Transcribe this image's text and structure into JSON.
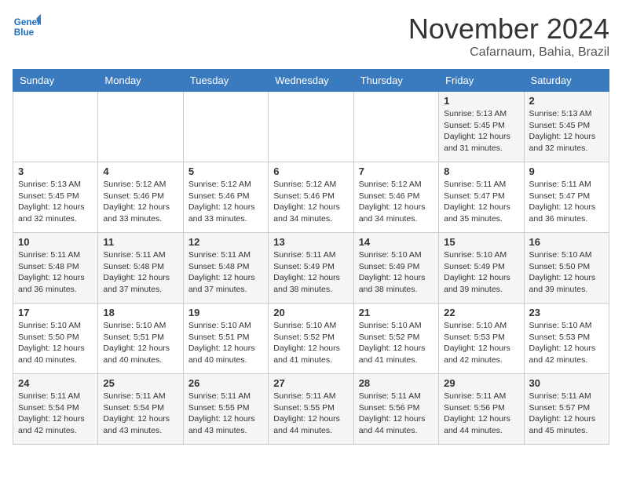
{
  "header": {
    "logo_line1": "General",
    "logo_line2": "Blue",
    "month": "November 2024",
    "location": "Cafarnaum, Bahia, Brazil"
  },
  "weekdays": [
    "Sunday",
    "Monday",
    "Tuesday",
    "Wednesday",
    "Thursday",
    "Friday",
    "Saturday"
  ],
  "weeks": [
    [
      {
        "day": "",
        "info": ""
      },
      {
        "day": "",
        "info": ""
      },
      {
        "day": "",
        "info": ""
      },
      {
        "day": "",
        "info": ""
      },
      {
        "day": "",
        "info": ""
      },
      {
        "day": "1",
        "info": "Sunrise: 5:13 AM\nSunset: 5:45 PM\nDaylight: 12 hours\nand 31 minutes."
      },
      {
        "day": "2",
        "info": "Sunrise: 5:13 AM\nSunset: 5:45 PM\nDaylight: 12 hours\nand 32 minutes."
      }
    ],
    [
      {
        "day": "3",
        "info": "Sunrise: 5:13 AM\nSunset: 5:45 PM\nDaylight: 12 hours\nand 32 minutes."
      },
      {
        "day": "4",
        "info": "Sunrise: 5:12 AM\nSunset: 5:46 PM\nDaylight: 12 hours\nand 33 minutes."
      },
      {
        "day": "5",
        "info": "Sunrise: 5:12 AM\nSunset: 5:46 PM\nDaylight: 12 hours\nand 33 minutes."
      },
      {
        "day": "6",
        "info": "Sunrise: 5:12 AM\nSunset: 5:46 PM\nDaylight: 12 hours\nand 34 minutes."
      },
      {
        "day": "7",
        "info": "Sunrise: 5:12 AM\nSunset: 5:46 PM\nDaylight: 12 hours\nand 34 minutes."
      },
      {
        "day": "8",
        "info": "Sunrise: 5:11 AM\nSunset: 5:47 PM\nDaylight: 12 hours\nand 35 minutes."
      },
      {
        "day": "9",
        "info": "Sunrise: 5:11 AM\nSunset: 5:47 PM\nDaylight: 12 hours\nand 36 minutes."
      }
    ],
    [
      {
        "day": "10",
        "info": "Sunrise: 5:11 AM\nSunset: 5:48 PM\nDaylight: 12 hours\nand 36 minutes."
      },
      {
        "day": "11",
        "info": "Sunrise: 5:11 AM\nSunset: 5:48 PM\nDaylight: 12 hours\nand 37 minutes."
      },
      {
        "day": "12",
        "info": "Sunrise: 5:11 AM\nSunset: 5:48 PM\nDaylight: 12 hours\nand 37 minutes."
      },
      {
        "day": "13",
        "info": "Sunrise: 5:11 AM\nSunset: 5:49 PM\nDaylight: 12 hours\nand 38 minutes."
      },
      {
        "day": "14",
        "info": "Sunrise: 5:10 AM\nSunset: 5:49 PM\nDaylight: 12 hours\nand 38 minutes."
      },
      {
        "day": "15",
        "info": "Sunrise: 5:10 AM\nSunset: 5:49 PM\nDaylight: 12 hours\nand 39 minutes."
      },
      {
        "day": "16",
        "info": "Sunrise: 5:10 AM\nSunset: 5:50 PM\nDaylight: 12 hours\nand 39 minutes."
      }
    ],
    [
      {
        "day": "17",
        "info": "Sunrise: 5:10 AM\nSunset: 5:50 PM\nDaylight: 12 hours\nand 40 minutes."
      },
      {
        "day": "18",
        "info": "Sunrise: 5:10 AM\nSunset: 5:51 PM\nDaylight: 12 hours\nand 40 minutes."
      },
      {
        "day": "19",
        "info": "Sunrise: 5:10 AM\nSunset: 5:51 PM\nDaylight: 12 hours\nand 40 minutes."
      },
      {
        "day": "20",
        "info": "Sunrise: 5:10 AM\nSunset: 5:52 PM\nDaylight: 12 hours\nand 41 minutes."
      },
      {
        "day": "21",
        "info": "Sunrise: 5:10 AM\nSunset: 5:52 PM\nDaylight: 12 hours\nand 41 minutes."
      },
      {
        "day": "22",
        "info": "Sunrise: 5:10 AM\nSunset: 5:53 PM\nDaylight: 12 hours\nand 42 minutes."
      },
      {
        "day": "23",
        "info": "Sunrise: 5:10 AM\nSunset: 5:53 PM\nDaylight: 12 hours\nand 42 minutes."
      }
    ],
    [
      {
        "day": "24",
        "info": "Sunrise: 5:11 AM\nSunset: 5:54 PM\nDaylight: 12 hours\nand 42 minutes."
      },
      {
        "day": "25",
        "info": "Sunrise: 5:11 AM\nSunset: 5:54 PM\nDaylight: 12 hours\nand 43 minutes."
      },
      {
        "day": "26",
        "info": "Sunrise: 5:11 AM\nSunset: 5:55 PM\nDaylight: 12 hours\nand 43 minutes."
      },
      {
        "day": "27",
        "info": "Sunrise: 5:11 AM\nSunset: 5:55 PM\nDaylight: 12 hours\nand 44 minutes."
      },
      {
        "day": "28",
        "info": "Sunrise: 5:11 AM\nSunset: 5:56 PM\nDaylight: 12 hours\nand 44 minutes."
      },
      {
        "day": "29",
        "info": "Sunrise: 5:11 AM\nSunset: 5:56 PM\nDaylight: 12 hours\nand 44 minutes."
      },
      {
        "day": "30",
        "info": "Sunrise: 5:11 AM\nSunset: 5:57 PM\nDaylight: 12 hours\nand 45 minutes."
      }
    ]
  ]
}
